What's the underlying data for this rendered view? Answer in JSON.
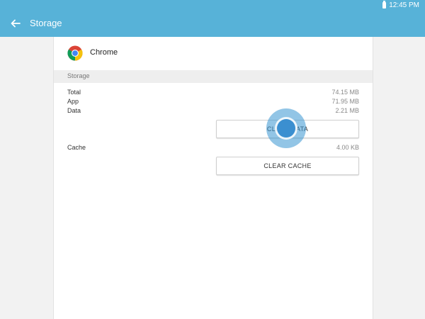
{
  "status_bar": {
    "time": "12:45 PM",
    "icons": [
      "battery-icon"
    ]
  },
  "app_bar": {
    "title": "Storage",
    "back_icon": "back-arrow-icon"
  },
  "app": {
    "name": "Chrome",
    "icon": "chrome-icon"
  },
  "storage": {
    "section_title": "Storage",
    "rows": [
      {
        "label": "Total",
        "value": "74.15 MB"
      },
      {
        "label": "App",
        "value": "71.95 MB"
      },
      {
        "label": "Data",
        "value": "2.21 MB"
      }
    ],
    "clear_data_label": "CLEAR DATA",
    "cache_label": "Cache",
    "cache_value": "4.00 KB",
    "clear_cache_label": "CLEAR CACHE"
  },
  "colors": {
    "accent": "#57b2d8",
    "touch_indicator": "#3b8fd0"
  }
}
